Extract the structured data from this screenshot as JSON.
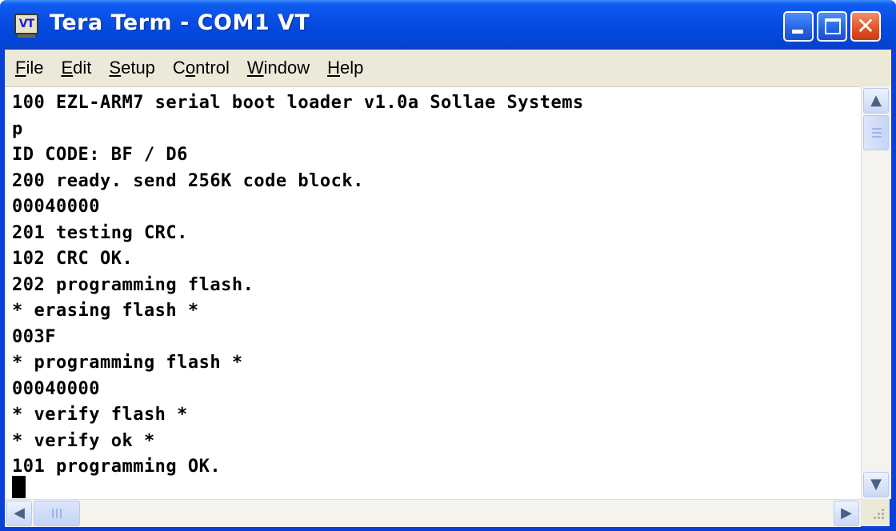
{
  "window": {
    "title": "Tera Term - COM1 VT",
    "icon": "tera-term-vt-icon",
    "icon_text": "VT",
    "controls": [
      "minimize-icon",
      "maximize-icon",
      "close-icon"
    ]
  },
  "menu": [
    {
      "key": "F",
      "rest": "ile"
    },
    {
      "key": "E",
      "rest": "dit"
    },
    {
      "key": "S",
      "rest": "etup"
    },
    {
      "pre": "C",
      "key": "o",
      "rest": "ntrol"
    },
    {
      "key": "W",
      "rest": "indow"
    },
    {
      "key": "H",
      "rest": "elp"
    }
  ],
  "terminal": {
    "lines": [
      "100 EZL-ARM7 serial boot loader v1.0a Sollae Systems",
      "p",
      "ID CODE: BF / D6",
      "200 ready. send 256K code block.",
      "00040000",
      "201 testing CRC.",
      "102 CRC OK.",
      "202 programming flash.",
      "* erasing flash *",
      "003F",
      "* programming flash *",
      "00040000",
      "* verify flash *",
      "* verify ok *",
      "101 programming OK."
    ]
  },
  "scrollbars": {
    "up": "▲",
    "down": "▼",
    "left": "◀",
    "right": "▶"
  },
  "colors": {
    "titlebar": "#0a52e8",
    "close_button": "#e2552c",
    "menubar": "#ece9d8",
    "terminal_bg": "#ffffff",
    "terminal_text": "#000000"
  }
}
